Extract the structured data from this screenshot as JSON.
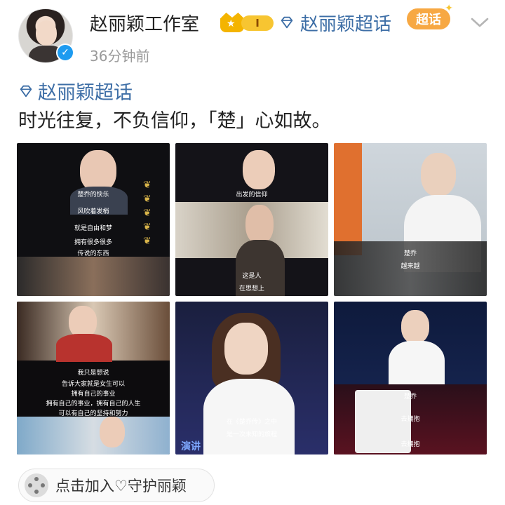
{
  "post": {
    "username": "赵丽颖工作室",
    "vip_level": "I",
    "topic_header": "赵丽颖超话",
    "chaohua_badge": "超话",
    "time": "36分钟前",
    "topic_tag": "赵丽颖超话",
    "content": "时光往复，不负信仰，「楚」心如故。"
  },
  "tiles": [
    {
      "captions": [
        "楚乔的快乐",
        "风吹着发梢",
        "就是自由和梦",
        "拥有很多很多",
        "传说的东西"
      ]
    },
    {
      "captions": [
        "出发的信仰",
        "这是人",
        "在思想上"
      ]
    },
    {
      "captions": [
        "楚乔",
        "越来越"
      ]
    },
    {
      "captions": [
        "我只是想说",
        "告诉大家就是女生可以",
        "拥有自己的事业",
        "拥有自己的事业，拥有自己的人生",
        "可以有自己的坚持和努力"
      ]
    },
    {
      "captions": [
        "演讲",
        "在《楚乔传》之中",
        "是一次未知的旅程"
      ]
    },
    {
      "captions": [
        "楚乔",
        "去拥抱",
        "去拥抱"
      ]
    }
  ],
  "footer": {
    "join_label": "点击加入♡守护丽颖"
  },
  "colors": {
    "link": "#3d6ea6",
    "verified": "#1d9bf0",
    "crown": "#f4b400",
    "chaohua": "#f7a843"
  },
  "icons": [
    "verified-icon",
    "crown-icon",
    "diamond-icon",
    "chevron-down-icon",
    "group-icon"
  ]
}
